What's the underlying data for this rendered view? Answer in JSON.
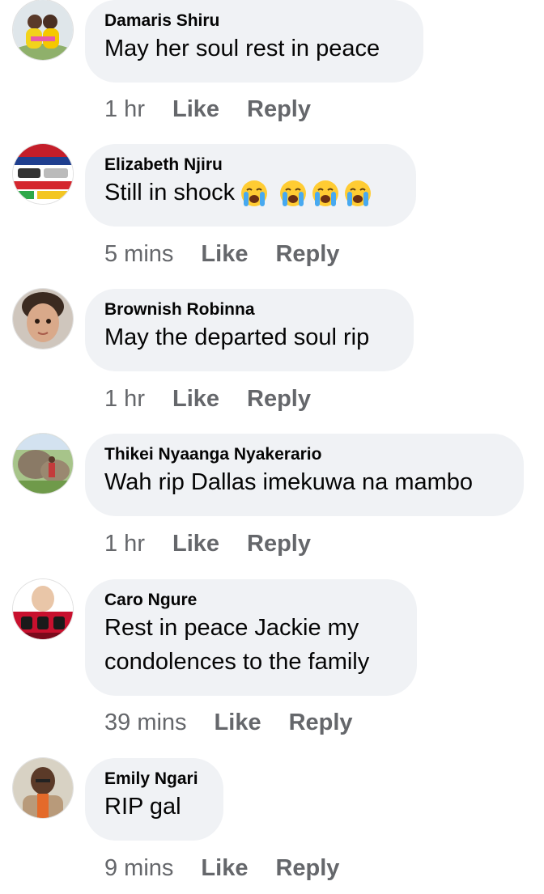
{
  "comments": [
    {
      "author": "Damaris Shiru",
      "text": "May her soul rest in peace",
      "time": "1 hr",
      "like": "Like",
      "reply": "Reply",
      "avatar": "avatar-two-children-yellow"
    },
    {
      "author": "Elizabeth Njiru",
      "text": "Still in shock",
      "emojis": [
        "loudly-crying-face-icon",
        "loudly-crying-face-icon",
        "loudly-crying-face-icon",
        "loudly-crying-face-icon"
      ],
      "time": "5 mins",
      "like": "Like",
      "reply": "Reply",
      "avatar": "avatar-car-advert"
    },
    {
      "author": "Brownish Robinna",
      "text": "May the departed soul rip",
      "time": "1 hr",
      "like": "Like",
      "reply": "Reply",
      "avatar": "avatar-child-portrait"
    },
    {
      "author": "Thikei Nyaanga Nyakerario",
      "text": "Wah rip Dallas imekuwa na mambo",
      "time": "1 hr",
      "like": "Like",
      "reply": "Reply",
      "avatar": "avatar-outdoor-rocks"
    },
    {
      "author": "Caro Ngure",
      "text_lines": [
        "Rest in peace Jackie my",
        "condolences to the family"
      ],
      "time": "39 mins",
      "like": "Like",
      "reply": "Reply",
      "avatar": "avatar-red-banner"
    },
    {
      "author": "Emily Ngari",
      "text": "RIP gal",
      "time": "9 mins",
      "like": "Like",
      "reply": "Reply",
      "avatar": "avatar-man-portrait"
    }
  ],
  "colors": {
    "bubble": "#f0f2f5",
    "meta": "#65676b",
    "text": "#050505"
  }
}
